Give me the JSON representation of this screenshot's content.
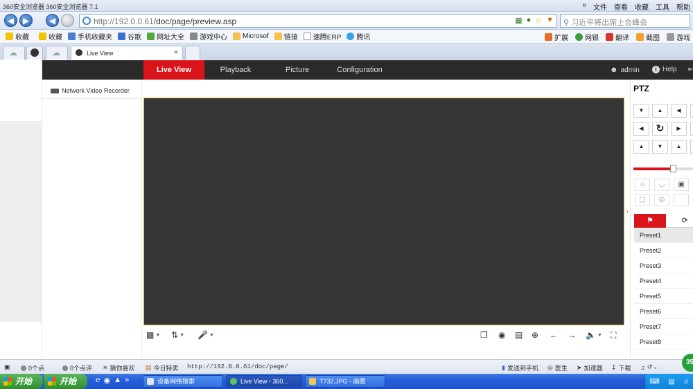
{
  "browser": {
    "title": "360安全浏览器 360安全浏览器 7.1",
    "menu": [
      "»",
      "文件",
      "查看",
      "收藏",
      "工具",
      "帮助"
    ],
    "url_host": "http://192.0.0.61",
    "url_path": "/doc/page/preview.asp",
    "search_placeholder": "习近平将出席上合峰会",
    "favorites": [
      "收藏",
      "收藏",
      "手机收藏夹",
      "谷歌",
      "网址大全",
      "游戏中心",
      "Microsof",
      "链接",
      "速腾ERP",
      "腾讯"
    ],
    "fav_right": [
      "扩展",
      "网银",
      "翻译",
      "截图",
      "游戏"
    ],
    "tab_label": "Live View",
    "tab_close": "×"
  },
  "app": {
    "nav": {
      "live_view": "Live View",
      "playback": "Playback",
      "picture": "Picture",
      "configuration": "Configuration",
      "user": "admin",
      "help": "Help"
    },
    "device_label": "Network Video Recorder",
    "ptz": {
      "title": "PTZ",
      "presets": [
        "Preset1",
        "Preset2",
        "Preset3",
        "Preset4",
        "Preset5",
        "Preset6",
        "Preset7",
        "Preset8"
      ],
      "speed_level": 0.66,
      "selected_preset": "Preset1"
    }
  },
  "statusbar": {
    "items": [
      "0个点",
      "0个点评",
      "猜你喜欢",
      "今日特卖"
    ],
    "url": "http://192.0.0.61/doc/page/",
    "right": [
      "发送到手机",
      "医生",
      "加速器",
      "下载"
    ],
    "badge": "35"
  },
  "taskbar": {
    "start1": "开始",
    "start2": "开始",
    "tasks": [
      "设备网络搜索",
      "Live View - 360...",
      "T732.JPG - 画图"
    ]
  },
  "colors": {
    "accent_red": "#d9141b",
    "nav_bg": "#2b2b2b",
    "video_bg": "#353535",
    "video_border": "#e2b233"
  }
}
